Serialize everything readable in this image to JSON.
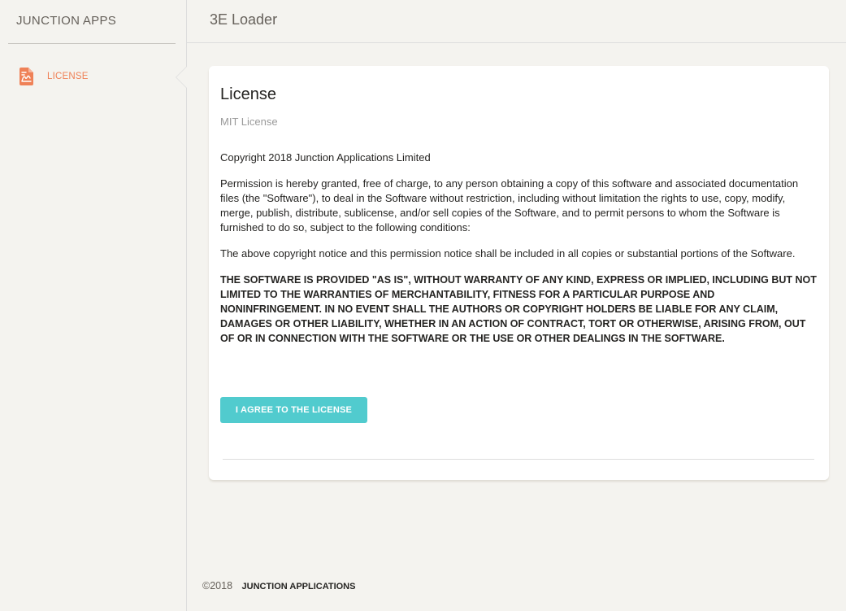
{
  "sidebar": {
    "brand": "JUNCTION APPS",
    "items": [
      {
        "label": "LICENSE",
        "icon": "file-document-icon",
        "active": true
      }
    ]
  },
  "header": {
    "title": "3E Loader"
  },
  "card": {
    "title": "License",
    "subtitle": "MIT License",
    "paragraphs": [
      "Copyright 2018 Junction Applications Limited",
      "Permission is hereby granted, free of charge, to any person obtaining a copy of this software and associated documentation files (the \"Software\"), to deal in the Software without restriction, including without limitation the rights to use, copy, modify, merge, publish, distribute, sublicense, and/or sell copies of the Software, and to permit persons to whom the Software is furnished to do so, subject to the following conditions:",
      "The above copyright notice and this permission notice shall be included in all copies or substantial portions of the Software."
    ],
    "warranty": "THE SOFTWARE IS PROVIDED \"AS IS\", WITHOUT WARRANTY OF ANY KIND, EXPRESS OR IMPLIED, INCLUDING BUT NOT LIMITED TO THE WARRANTIES OF MERCHANTABILITY, FITNESS FOR A PARTICULAR PURPOSE AND NONINFRINGEMENT. IN NO EVENT SHALL THE AUTHORS OR COPYRIGHT HOLDERS BE LIABLE FOR ANY CLAIM, DAMAGES OR OTHER LIABILITY, WHETHER IN AN ACTION OF CONTRACT, TORT OR OTHERWISE, ARISING FROM, OUT OF OR IN CONNECTION WITH THE SOFTWARE OR THE USE OR OTHER DEALINGS IN THE SOFTWARE.",
    "agree_label": "I AGREE TO THE LICENSE"
  },
  "footer": {
    "copyright": "©2018",
    "company": "JUNCTION APPLICATIONS"
  },
  "colors": {
    "accent": "#ef8157",
    "button": "#51cbce",
    "background": "#f4f3ef"
  }
}
